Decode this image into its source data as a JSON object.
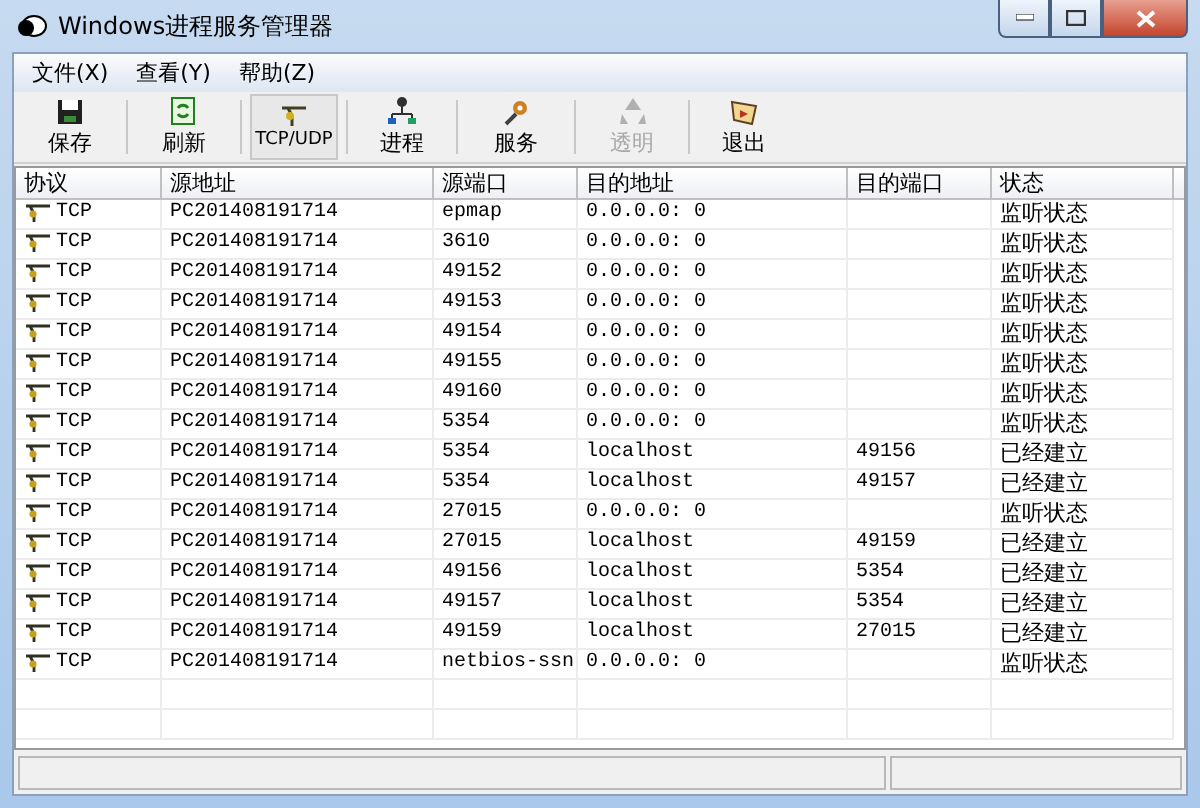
{
  "window": {
    "title": "Windows进程服务管理器"
  },
  "menu": [
    "文件(X)",
    "查看(Y)",
    "帮助(Z)"
  ],
  "toolbar": [
    {
      "label": "保存",
      "kind": "save",
      "selected": false,
      "disabled": false
    },
    {
      "label": "刷新",
      "kind": "refresh",
      "selected": false,
      "disabled": false
    },
    {
      "label": "TCP/UDP",
      "kind": "network",
      "selected": true,
      "disabled": false
    },
    {
      "label": "进程",
      "kind": "process",
      "selected": false,
      "disabled": false
    },
    {
      "label": "服务",
      "kind": "service",
      "selected": false,
      "disabled": false
    },
    {
      "label": "透明",
      "kind": "transparent",
      "selected": false,
      "disabled": true
    },
    {
      "label": "退出",
      "kind": "exit",
      "selected": false,
      "disabled": false
    }
  ],
  "table": {
    "columns": [
      "协议",
      "源地址",
      "源端口",
      "目的地址",
      "目的端口",
      "状态"
    ],
    "rows": [
      [
        "TCP",
        "PC201408191714",
        "epmap",
        "0.0.0.0: 0",
        "",
        "监听状态"
      ],
      [
        "TCP",
        "PC201408191714",
        "3610",
        "0.0.0.0: 0",
        "",
        "监听状态"
      ],
      [
        "TCP",
        "PC201408191714",
        "49152",
        "0.0.0.0: 0",
        "",
        "监听状态"
      ],
      [
        "TCP",
        "PC201408191714",
        "49153",
        "0.0.0.0: 0",
        "",
        "监听状态"
      ],
      [
        "TCP",
        "PC201408191714",
        "49154",
        "0.0.0.0: 0",
        "",
        "监听状态"
      ],
      [
        "TCP",
        "PC201408191714",
        "49155",
        "0.0.0.0: 0",
        "",
        "监听状态"
      ],
      [
        "TCP",
        "PC201408191714",
        "49160",
        "0.0.0.0: 0",
        "",
        "监听状态"
      ],
      [
        "TCP",
        "PC201408191714",
        "5354",
        "0.0.0.0: 0",
        "",
        "监听状态"
      ],
      [
        "TCP",
        "PC201408191714",
        "5354",
        "localhost",
        "49156",
        "已经建立"
      ],
      [
        "TCP",
        "PC201408191714",
        "5354",
        "localhost",
        "49157",
        "已经建立"
      ],
      [
        "TCP",
        "PC201408191714",
        "27015",
        "0.0.0.0: 0",
        "",
        "监听状态"
      ],
      [
        "TCP",
        "PC201408191714",
        "27015",
        "localhost",
        "49159",
        "已经建立"
      ],
      [
        "TCP",
        "PC201408191714",
        "49156",
        "localhost",
        "5354",
        "已经建立"
      ],
      [
        "TCP",
        "PC201408191714",
        "49157",
        "localhost",
        "5354",
        "已经建立"
      ],
      [
        "TCP",
        "PC201408191714",
        "49159",
        "localhost",
        "27015",
        "已经建立"
      ],
      [
        "TCP",
        "PC201408191714",
        "netbios-ssn",
        "0.0.0.0: 0",
        "",
        "监听状态"
      ]
    ]
  }
}
